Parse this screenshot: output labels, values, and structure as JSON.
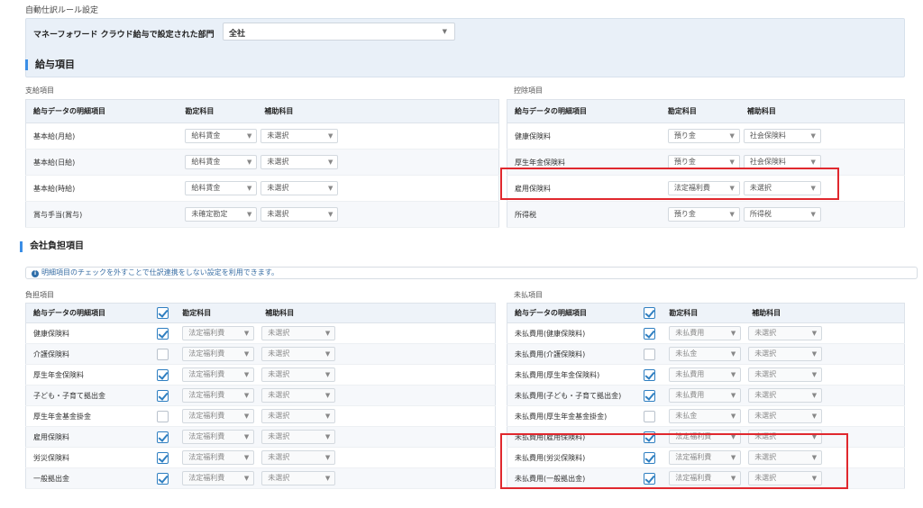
{
  "page_title": "自動仕訳ルール設定",
  "dept": {
    "label": "マネーフォワード クラウド給与で設定された部門",
    "value": "全社"
  },
  "salary": {
    "title": "給与項目",
    "payment": {
      "label": "支給項目",
      "headers": [
        "給与データの明細項目",
        "勘定科目",
        "補助科目"
      ],
      "rows": [
        {
          "item": "基本給(月給)",
          "account": "給料賃金",
          "sub": "未選択"
        },
        {
          "item": "基本給(日給)",
          "account": "給料賃金",
          "sub": "未選択"
        },
        {
          "item": "基本給(時給)",
          "account": "給料賃金",
          "sub": "未選択"
        },
        {
          "item": "賞与手当(賞与)",
          "account": "未確定勘定",
          "sub": "未選択"
        }
      ]
    },
    "deduction": {
      "label": "控除項目",
      "headers": [
        "給与データの明細項目",
        "勘定科目",
        "補助科目"
      ],
      "rows": [
        {
          "item": "健康保険料",
          "account": "預り金",
          "sub": "社会保険料"
        },
        {
          "item": "厚生年金保険料",
          "account": "預り金",
          "sub": "社会保険料"
        },
        {
          "item": "雇用保険料",
          "account": "法定福利費",
          "sub": "未選択"
        },
        {
          "item": "所得税",
          "account": "預り金",
          "sub": "所得税"
        }
      ]
    }
  },
  "company": {
    "title": "会社負担項目",
    "info": "明細項目のチェックを外すことで仕訳連携をしない設定を利用できます。",
    "burden": {
      "label": "負担項目",
      "headers": [
        "給与データの明細項目",
        "勘定科目",
        "補助科目"
      ],
      "header_checked": true,
      "rows": [
        {
          "item": "健康保険料",
          "checked": true,
          "account": "法定福利費",
          "sub": "未選択"
        },
        {
          "item": "介護保険料",
          "checked": false,
          "account": "法定福利費",
          "sub": "未選択"
        },
        {
          "item": "厚生年金保険料",
          "checked": true,
          "account": "法定福利費",
          "sub": "未選択"
        },
        {
          "item": "子ども・子育て拠出金",
          "checked": true,
          "account": "法定福利費",
          "sub": "未選択"
        },
        {
          "item": "厚生年金基金掛金",
          "checked": false,
          "account": "法定福利費",
          "sub": "未選択"
        },
        {
          "item": "雇用保険料",
          "checked": true,
          "account": "法定福利費",
          "sub": "未選択"
        },
        {
          "item": "労災保険料",
          "checked": true,
          "account": "法定福利費",
          "sub": "未選択"
        },
        {
          "item": "一般拠出金",
          "checked": true,
          "account": "法定福利費",
          "sub": "未選択"
        }
      ]
    },
    "unpaid": {
      "label": "未払項目",
      "headers": [
        "給与データの明細項目",
        "勘定科目",
        "補助科目"
      ],
      "header_checked": true,
      "rows": [
        {
          "item": "未払費用(健康保険料)",
          "checked": true,
          "account": "未払費用",
          "sub": "未選択"
        },
        {
          "item": "未払費用(介護保険料)",
          "checked": false,
          "account": "未払金",
          "sub": "未選択"
        },
        {
          "item": "未払費用(厚生年金保険料)",
          "checked": true,
          "account": "未払費用",
          "sub": "未選択"
        },
        {
          "item": "未払費用(子ども・子育て拠出金)",
          "checked": true,
          "account": "未払費用",
          "sub": "未選択"
        },
        {
          "item": "未払費用(厚生年金基金掛金)",
          "checked": false,
          "account": "未払金",
          "sub": "未選択"
        },
        {
          "item": "未払費用(雇用保険料)",
          "checked": true,
          "account": "法定福利費",
          "sub": "未選択"
        },
        {
          "item": "未払費用(労災保険料)",
          "checked": true,
          "account": "法定福利費",
          "sub": "未選択"
        },
        {
          "item": "未払費用(一般拠出金)",
          "checked": true,
          "account": "法定福利費",
          "sub": "未選択"
        }
      ]
    }
  },
  "colors": {
    "accent": "#3a8ee6",
    "highlight": "#e0282e",
    "header_bg": "#eef3f9"
  }
}
